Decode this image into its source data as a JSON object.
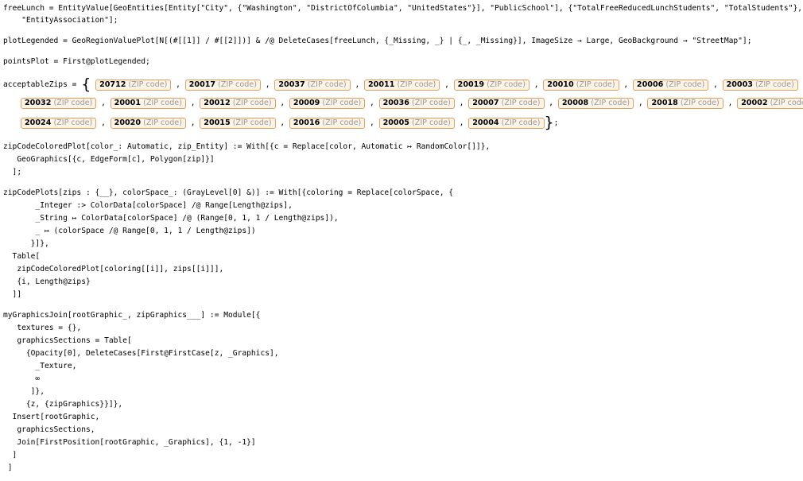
{
  "lines": {
    "l1": "freeLunch = EntityValue[GeoEntities[Entity[\"City\", {\"Washington\", \"DistrictOfColumbia\", \"UnitedStates\"}], \"PublicSchool\"], {\"TotalFreeReducedLunchStudents\", \"TotalStudents\"},",
    "l2": "    \"EntityAssociation\"];",
    "l3": "plotLegended = GeoRegionValuePlot[N[(#[[1]] / #[[2]])] & /@ DeleteCases[freeLunch, {_Missing, _} | {_, _Missing}], ImageSize → Large, GeoBackground → \"StreetMap\"];",
    "l4": "pointsPlot = First@plotLegended;",
    "az_label": "acceptableZips = ",
    "l5": "zipCodeColoredPlot[color_: Automatic, zip_Entity] := With[{c = Replace[color, Automatic ↦ RandomColor[]]},",
    "l6": "   GeoGraphics[{c, EdgeForm[c], Polygon[zip]}]",
    "l7": "  ];",
    "l8": "zipCodePlots[zips : {__}, colorSpace_: (GrayLevel[0] &)] := With[{coloring = Replace[colorSpace, {",
    "l9": "       _Integer :> ColorData[colorSpace] /@ Range[Length@zips],",
    "l10": "       _String ↦ ColorData[colorSpace] /@ (Range[0, 1, 1 / Length@zips]),",
    "l11": "       _ ↦ (colorSpace /@ Range[0, 1, 1 / Length@zips])",
    "l12": "      }]},",
    "l13": "  Table[",
    "l14": "   zipCodeColoredPlot[coloring[[i]], zips[[i]]],",
    "l15": "   {i, Length@zips}",
    "l16": "  ]]",
    "l17": "myGraphicsJoin[rootGraphic_, zipGraphics___] := Module[{",
    "l18": "   textures = {},",
    "l19": "   graphicsSections = Table[",
    "l20": "     {Opacity[0], DeleteCases[First@FirstCase[z, _Graphics],",
    "l21": "       _Texture,",
    "l22": "       ∞",
    "l23": "      ]},",
    "l24": "     {z, {zipGraphics}}]},",
    "l25": "  Insert[rootGraphic,",
    "l26": "   graphicsSections,",
    "l27": "   Join[FirstPosition[rootGraphic, _Graphics], {1, -1}]",
    "l28": "  ]",
    "l29": " ]"
  },
  "zip_tag": "(ZIP code)",
  "zip_rows": [
    [
      "20712",
      "20017",
      "20037",
      "20011",
      "20019",
      "20010",
      "20006",
      "20003"
    ],
    [
      "20032",
      "20001",
      "20012",
      "20009",
      "20036",
      "20007",
      "20008",
      "20018",
      "20002"
    ],
    [
      "20024",
      "20020",
      "20015",
      "20016",
      "20005",
      "20004"
    ]
  ]
}
